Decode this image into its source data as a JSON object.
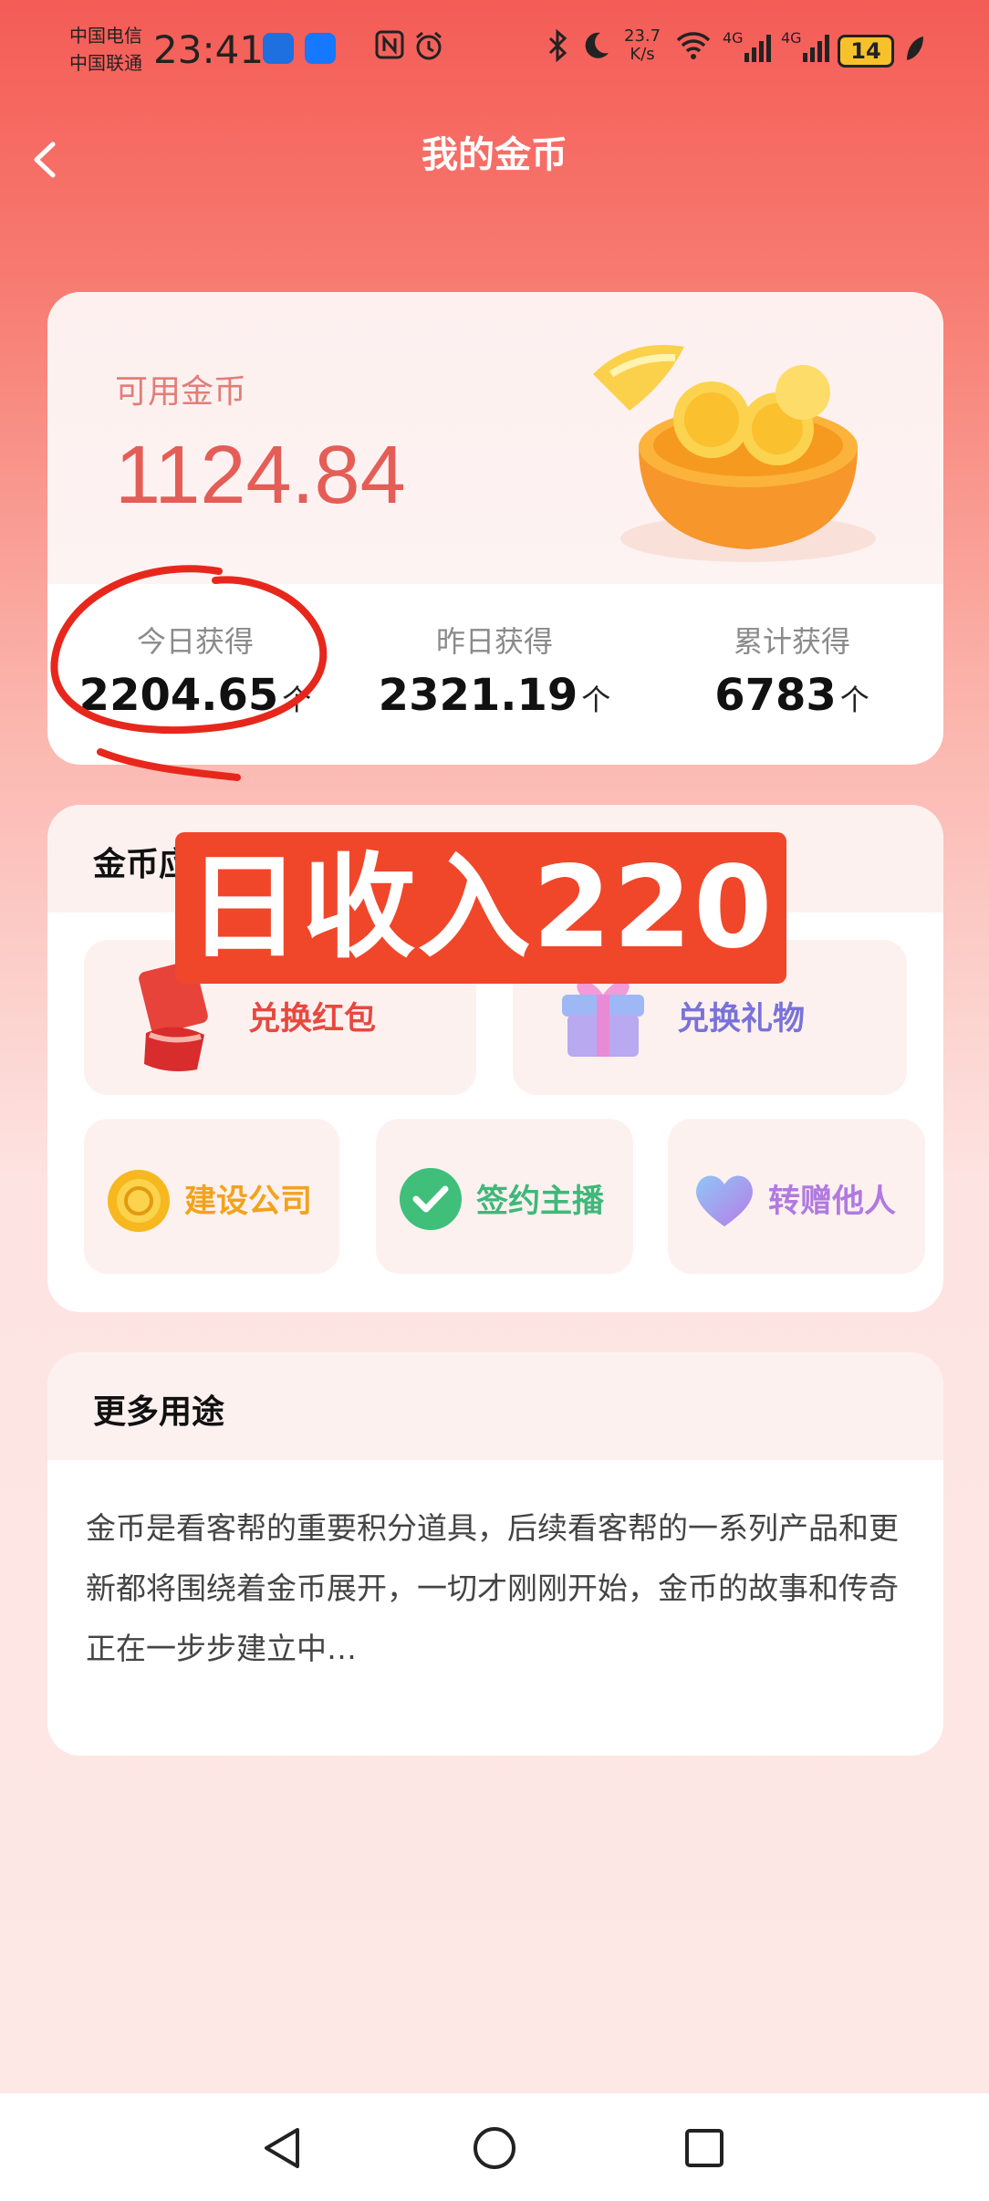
{
  "status_bar": {
    "carrier_1": "中国电信",
    "carrier_2": "中国联通",
    "time": "23:41",
    "net_speed_value": "23.7",
    "net_speed_unit": "K/s",
    "signal_1": "4G",
    "signal_2": "4G",
    "battery": "14"
  },
  "header": {
    "title": "我的金币"
  },
  "wallet": {
    "available_label": "可用金币",
    "available_amount": "1124.84",
    "stats": [
      {
        "label": "今日获得",
        "value": "2204.65",
        "unit": "个"
      },
      {
        "label": "昨日获得",
        "value": "2321.19",
        "unit": "个"
      },
      {
        "label": "累计获得",
        "value": "6783",
        "unit": "个"
      }
    ]
  },
  "apps": {
    "title": "金币应用",
    "items": [
      {
        "label": "兑换红包",
        "color": "#e8483e",
        "icon": "red-envelope-icon"
      },
      {
        "label": "兑换礼物",
        "color": "#7a72d8",
        "icon": "gift-box-icon"
      },
      {
        "label": "建设公司",
        "color": "#f2a21c",
        "icon": "gold-coin-icon"
      },
      {
        "label": "签约主播",
        "color": "#3fb87a",
        "icon": "check-circle-icon"
      },
      {
        "label": "转赠他人",
        "color": "#b07ae0",
        "icon": "heart-icon"
      }
    ]
  },
  "banner": {
    "text": "日收入220",
    "color": "#f0462a"
  },
  "more": {
    "title": "更多用途",
    "description": "金币是看客帮的重要积分道具，后续看客帮的一系列产品和更新都将围绕着金币展开，一切才刚刚开始，金币的故事和传奇正在一步步建立中…"
  }
}
